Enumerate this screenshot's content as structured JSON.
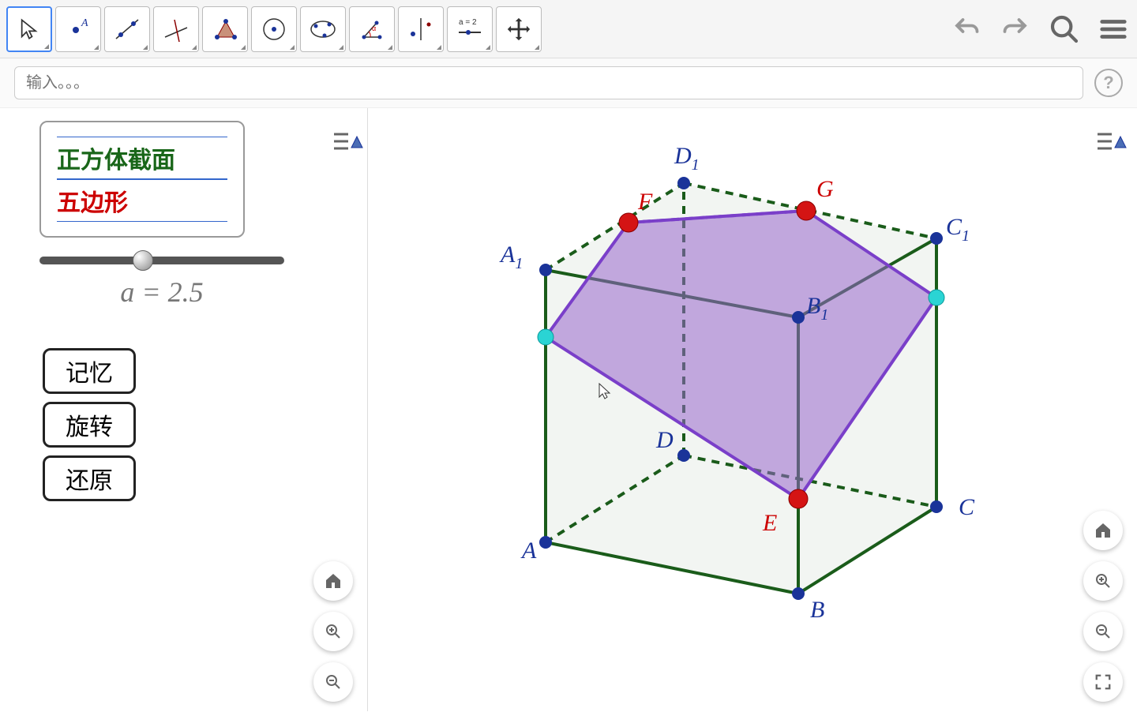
{
  "input": {
    "placeholder": "输入。。。"
  },
  "info": {
    "title": "正方体截面",
    "shape": "五边形"
  },
  "slider": {
    "label": "a = 2.5",
    "value": 2.5,
    "min": 0,
    "max": 6
  },
  "buttons": {
    "memory": "记忆",
    "rotate": "旋转",
    "restore": "还原"
  },
  "labels": {
    "A": "A",
    "B": "B",
    "C": "C",
    "D": "D",
    "A1": "A",
    "B1": "B",
    "C1": "C",
    "D1": "D",
    "E": "E",
    "F": "F",
    "G": "G"
  },
  "geometry": {
    "description": "Cube ABCD-A1B1C1D1 with cross-section pentagon through E,F,G and two cyan intersection points",
    "cube_vertices": [
      "A",
      "B",
      "C",
      "D",
      "A1",
      "B1",
      "C1",
      "D1"
    ],
    "section_points": [
      "E",
      "F",
      "G"
    ],
    "section_type": "pentagon"
  }
}
